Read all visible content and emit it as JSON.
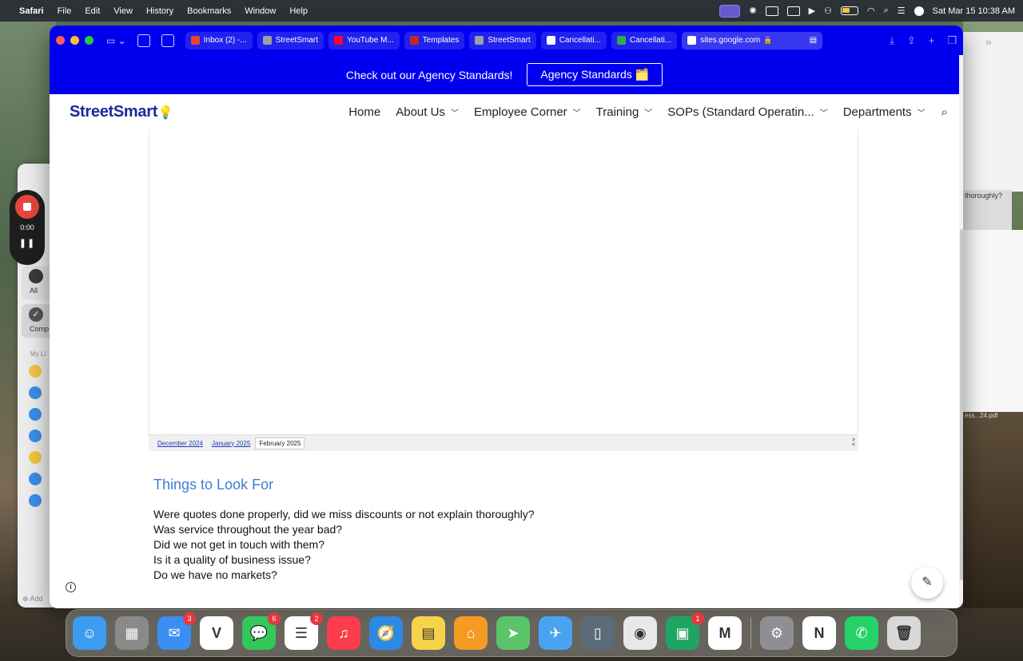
{
  "menubar": {
    "app": "Safari",
    "items": [
      "File",
      "Edit",
      "View",
      "History",
      "Bookmarks",
      "Window",
      "Help"
    ],
    "clock": "Sat Mar 15  10:38 AM"
  },
  "reminders": {
    "all_label": "All",
    "completed_label": "Comp",
    "mylists_label": "My Li",
    "add_label": "Add",
    "list_colors": [
      "#f5c542",
      "#3b8ee8",
      "#3b8ee8",
      "#3b8ee8",
      "#f5c542",
      "#3b8ee8",
      "#3b8ee8"
    ]
  },
  "recorder": {
    "time": "0:00"
  },
  "right_peek": {
    "text": "thoroughly?",
    "file": "ess...24.pdf"
  },
  "safari": {
    "tabs": [
      {
        "label": "Inbox (2) -...",
        "color": "#ea4335"
      },
      {
        "label": "StreetSmart",
        "color": "#9aa0a6"
      },
      {
        "label": "YouTube M...",
        "color": "#ff0033"
      },
      {
        "label": "Templates",
        "color": "#c62828"
      },
      {
        "label": "StreetSmart",
        "color": "#9aa0a6"
      },
      {
        "label": "Cancellati...",
        "color": "#ffffff"
      },
      {
        "label": "Cancellati...",
        "color": "#34a853"
      }
    ],
    "active_tab": "sites.google.com"
  },
  "banner": {
    "text": "Check out our Agency Standards!",
    "button": "Agency Standards 🗂️"
  },
  "site": {
    "logo": "StreetSmart",
    "nav": [
      {
        "label": "Home",
        "chevron": false
      },
      {
        "label": "About Us",
        "chevron": true
      },
      {
        "label": "Employee Corner",
        "chevron": true
      },
      {
        "label": "Training",
        "chevron": true
      },
      {
        "label": "SOPs (Standard Operatin...",
        "chevron": true
      },
      {
        "label": "Departments",
        "chevron": true
      }
    ]
  },
  "sheet": {
    "tabs": [
      "December 2024",
      "January 2025",
      "February 2025"
    ],
    "active_tab": "February 2025"
  },
  "content": {
    "heading": "Things to Look For",
    "lines": [
      "Were quotes done properly, did we miss discounts or not explain thoroughly?",
      "Was service throughout the year bad?",
      "Did we not get in touch with them?",
      "Is it a quality of business issue?",
      "Do we have no markets?"
    ]
  },
  "dock": {
    "apps": [
      {
        "name": "finder",
        "color": "#3b9cf0",
        "badge": ""
      },
      {
        "name": "launchpad",
        "color": "#8a8a8a",
        "badge": ""
      },
      {
        "name": "mail",
        "color": "#3a8ff0",
        "badge": "3"
      },
      {
        "name": "vectorworks",
        "color": "#ffffff",
        "badge": ""
      },
      {
        "name": "messages",
        "color": "#34c759",
        "badge": "6"
      },
      {
        "name": "reminders",
        "color": "#ffffff",
        "badge": "2"
      },
      {
        "name": "music",
        "color": "#fa3c4c",
        "badge": ""
      },
      {
        "name": "safari",
        "color": "#2b8ae6",
        "badge": ""
      },
      {
        "name": "notes",
        "color": "#f7d24b",
        "badge": ""
      },
      {
        "name": "home",
        "color": "#f59a23",
        "badge": ""
      },
      {
        "name": "maps",
        "color": "#5ac46a",
        "badge": ""
      },
      {
        "name": "testflight",
        "color": "#4aa3f0",
        "badge": ""
      },
      {
        "name": "iphone-mirroring",
        "color": "#5b6b7a",
        "badge": ""
      },
      {
        "name": "chrome",
        "color": "#e8e8e8",
        "badge": ""
      },
      {
        "name": "google-chat",
        "color": "#1fa463",
        "badge": "1"
      },
      {
        "name": "gmail",
        "color": "#ffffff",
        "badge": ""
      },
      {
        "name": "system-settings",
        "color": "#8e8e93",
        "badge": ""
      },
      {
        "name": "news",
        "color": "#ffffff",
        "badge": ""
      },
      {
        "name": "whatsapp",
        "color": "#25d366",
        "badge": ""
      },
      {
        "name": "trash",
        "color": "#d8d8d8",
        "badge": ""
      }
    ]
  }
}
